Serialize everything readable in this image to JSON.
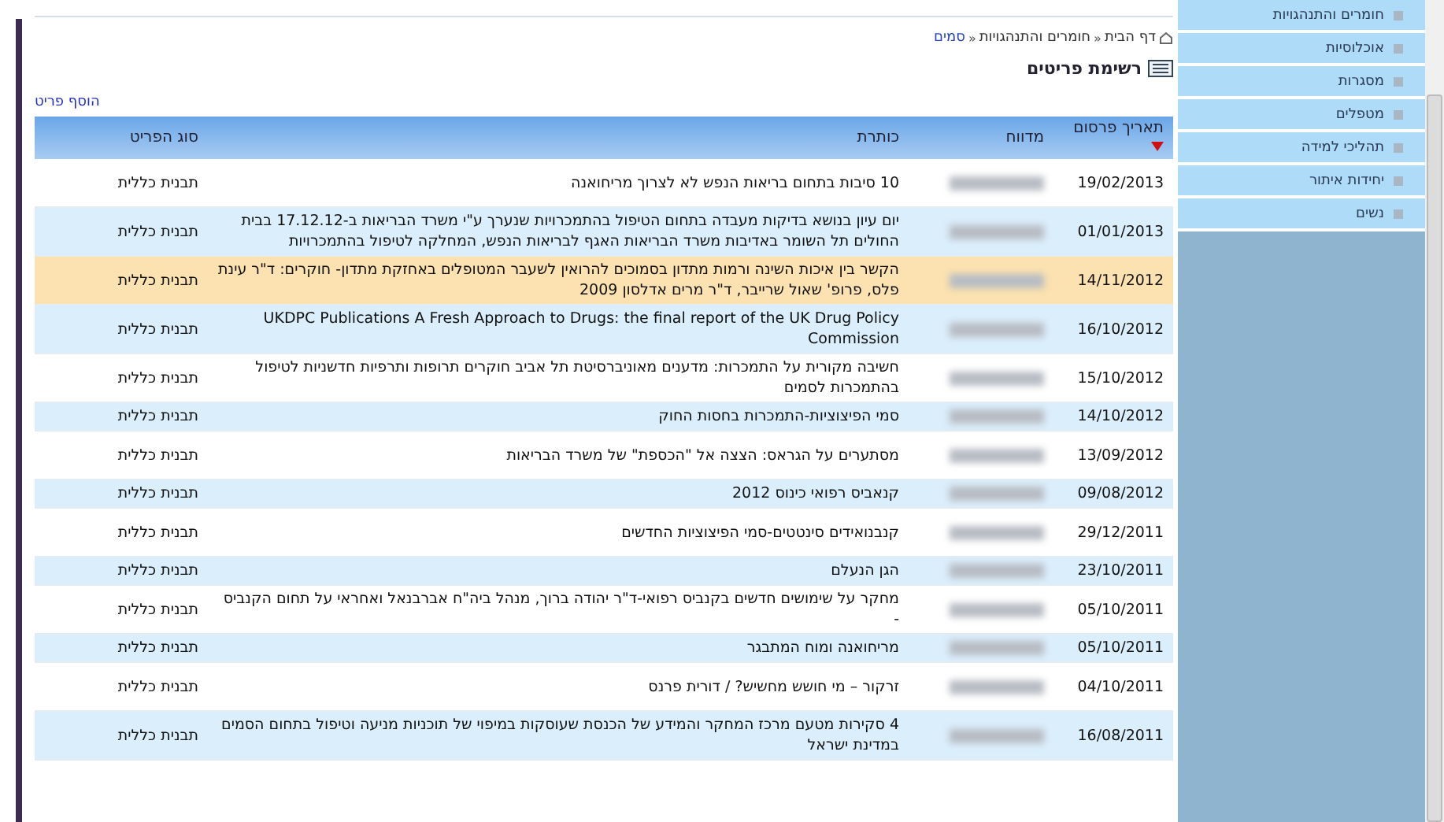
{
  "breadcrumb": {
    "items": [
      {
        "label": "דף הבית",
        "current": false
      },
      {
        "label": "חומרים והתנהגויות",
        "current": false
      },
      {
        "label": "סמים",
        "current": true
      }
    ],
    "separator": "«"
  },
  "heading": "רשימת פריטים",
  "add_link": "הוסף פריט",
  "table": {
    "columns": [
      {
        "label": "תאריך פרסום",
        "sorted": true
      },
      {
        "label": "מדווח",
        "sorted": false
      },
      {
        "label": "כותרת",
        "sorted": false
      },
      {
        "label": "סוג הפריט",
        "sorted": false
      }
    ],
    "rows": [
      {
        "date": "19/02/2013",
        "title": "10 סיבות בתחום בריאות הנפש לא לצרוך מריחואנה",
        "type": "תבנית כללית",
        "highlighted": false
      },
      {
        "date": "01/01/2013",
        "title": "יום עיון בנושא בדיקות מעבדה בתחום הטיפול בהתמכרויות שנערך ע\"י משרד הבריאות ב-17.12.12 בבית החולים תל השומר באדיבות משרד הבריאות האגף לבריאות הנפש, המחלקה לטיפול בהתמכרויות",
        "type": "תבנית כללית",
        "highlighted": false
      },
      {
        "date": "14/11/2012",
        "title": "הקשר בין איכות השינה ורמות מתדון בסמוכים להרואין לשעבר המטופלים באחזקת מתדון- חוקרים: ד\"ר עינת פלס, פרופ' שאול שרייבר, ד\"ר מרים אדלסון 2009",
        "type": "תבנית כללית",
        "highlighted": true
      },
      {
        "date": "16/10/2012",
        "title": "UKDPC Publications A Fresh Approach to Drugs: the final report of the UK Drug Policy Commission",
        "type": "תבנית כללית",
        "highlighted": false
      },
      {
        "date": "15/10/2012",
        "title": "חשיבה מקורית על התמכרות: מדענים מאוניברסיטת תל אביב חוקרים תרופות ותרפיות חדשניות לטיפול בהתמכרות לסמים",
        "type": "תבנית כללית",
        "highlighted": false
      },
      {
        "date": "14/10/2012",
        "title": "סמי הפיצוציות-התמכרות בחסות החוק",
        "type": "תבנית כללית",
        "highlighted": false
      },
      {
        "date": "13/09/2012",
        "title": "מסתערים על הגראס: הצצה אל \"הכספת\" של משרד הבריאות",
        "type": "תבנית כללית",
        "highlighted": false
      },
      {
        "date": "09/08/2012",
        "title": "קנאביס רפואי כינוס 2012",
        "type": "תבנית כללית",
        "highlighted": false
      },
      {
        "date": "29/12/2011",
        "title": "קנבנואידים סינטטים-סמי הפיצוציות החדשים",
        "type": "תבנית כללית",
        "highlighted": false
      },
      {
        "date": "23/10/2011",
        "title": "הגן הנעלם",
        "type": "תבנית כללית",
        "highlighted": false
      },
      {
        "date": "05/10/2011",
        "title": "מחקר על שימושים חדשים בקנביס רפואי-ד\"ר יהודה ברוך, מנהל ביה\"ח אברבנאל ואחראי על תחום הקנביס -",
        "type": "תבנית כללית",
        "highlighted": false
      },
      {
        "date": "05/10/2011",
        "title": "מריחואנה ומוח המתבגר",
        "type": "תבנית כללית",
        "highlighted": false
      },
      {
        "date": "04/10/2011",
        "title": "זרקור – מי חושש מחשיש? / דורית פרנס",
        "type": "תבנית כללית",
        "highlighted": false
      },
      {
        "date": "16/08/2011",
        "title": "4 סקירות מטעם מרכז המחקר והמידע של הכנסת שעוסקות במיפוי של תוכניות מניעה וטיפול בתחום הסמים במדינת ישראל",
        "type": "תבנית כללית",
        "highlighted": false
      }
    ]
  },
  "sidebar": {
    "items": [
      {
        "label": "חומרים והתנהגויות"
      },
      {
        "label": "אוכלוסיות"
      },
      {
        "label": "מסגרות"
      },
      {
        "label": "מטפלים"
      },
      {
        "label": "תהליכי למידה"
      },
      {
        "label": "יחידות איתור"
      },
      {
        "label": "נשים"
      }
    ]
  }
}
